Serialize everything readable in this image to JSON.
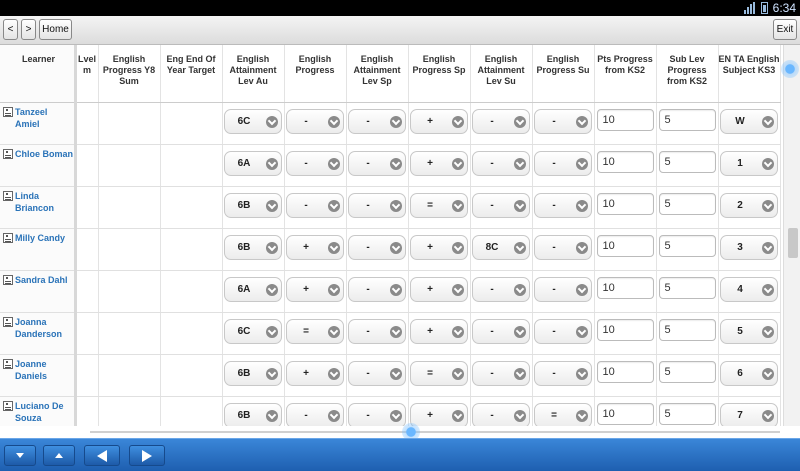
{
  "status": {
    "time": "6:34",
    "signal_icon": "signal-icon",
    "battery_icon": "battery-icon"
  },
  "toolbar": {
    "back_label": "<",
    "forward_label": ">",
    "home_label": "Home",
    "exit_label": "Exit"
  },
  "columns": [
    "Learner",
    "Lvel m",
    "English Progress Y8 Sum",
    "Eng End Of Year Target",
    "English Attainment Lev Au",
    "English Progress",
    "English Attainment Lev Sp",
    "English Progress Sp",
    "English Attainment Lev Su",
    "English Progress Su",
    "Pts Progress from KS2",
    "Sub Lev Progress from KS2",
    "EN TA English Subject KS3"
  ],
  "rows": [
    {
      "name": "Tanzeel Amiel",
      "att_au": "6C",
      "prog": "-",
      "att_sp": "-",
      "prog_sp": "+",
      "att_su": "-",
      "prog_su": "-",
      "pts": "10",
      "sub": "5",
      "ta": "W"
    },
    {
      "name": "Chloe Boman",
      "att_au": "6A",
      "prog": "-",
      "att_sp": "-",
      "prog_sp": "+",
      "att_su": "-",
      "prog_su": "-",
      "pts": "10",
      "sub": "5",
      "ta": "1"
    },
    {
      "name": "Linda Briancon",
      "att_au": "6B",
      "prog": "-",
      "att_sp": "-",
      "prog_sp": "=",
      "att_su": "-",
      "prog_su": "-",
      "pts": "10",
      "sub": "5",
      "ta": "2"
    },
    {
      "name": "Milly Candy",
      "att_au": "6B",
      "prog": "+",
      "att_sp": "-",
      "prog_sp": "+",
      "att_su": "8C",
      "prog_su": "-",
      "pts": "10",
      "sub": "5",
      "ta": "3"
    },
    {
      "name": "Sandra Dahl",
      "att_au": "6A",
      "prog": "+",
      "att_sp": "-",
      "prog_sp": "+",
      "att_su": "-",
      "prog_su": "-",
      "pts": "10",
      "sub": "5",
      "ta": "4"
    },
    {
      "name": "Joanna Danderson",
      "att_au": "6C",
      "prog": "=",
      "att_sp": "-",
      "prog_sp": "+",
      "att_su": "-",
      "prog_su": "-",
      "pts": "10",
      "sub": "5",
      "ta": "5"
    },
    {
      "name": "Joanne Daniels",
      "att_au": "6B",
      "prog": "+",
      "att_sp": "-",
      "prog_sp": "=",
      "att_su": "-",
      "prog_su": "-",
      "pts": "10",
      "sub": "5",
      "ta": "6"
    },
    {
      "name": "Luciano De Souza",
      "att_au": "6B",
      "prog": "-",
      "att_sp": "-",
      "prog_sp": "+",
      "att_su": "-",
      "prog_su": "=",
      "pts": "10",
      "sub": "5",
      "ta": "7"
    }
  ],
  "bottombar": {
    "down_icon": "arrow-down-icon",
    "up_icon": "arrow-up-icon",
    "prev_icon": "arrow-left-icon",
    "next_icon": "arrow-right-icon"
  },
  "colors": {
    "toolbar_bg": "#e6e6e6",
    "name_link": "#2a73b8",
    "bottom_bar": "#2a70c4",
    "status_bar": "#000000"
  }
}
